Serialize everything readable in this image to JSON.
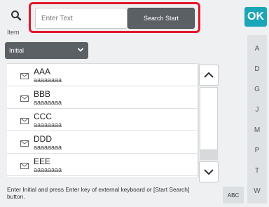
{
  "header": {
    "search_icon": "search-icon",
    "item_label": "Item",
    "text_placeholder": "Enter Text",
    "search_start_label": "Search Start",
    "ok_label": "OK",
    "highlight_color": "#e2172b",
    "ok_color": "#1aa5b8"
  },
  "filter": {
    "selected": "Initial"
  },
  "list": {
    "rows": [
      {
        "name": "AAA",
        "sub": "aaaaaaaa"
      },
      {
        "name": "BBB",
        "sub": "aaaaaaaa"
      },
      {
        "name": "CCC",
        "sub": "aaaaaaaa"
      },
      {
        "name": "DDD",
        "sub": "aaaaaaaa"
      },
      {
        "name": "EEE",
        "sub": "aaaaaaaa"
      }
    ]
  },
  "index": [
    "A",
    "D",
    "G",
    "J",
    "M",
    "P",
    "T",
    "W"
  ],
  "footer": {
    "hint": "Enter Initial and press Enter key of external keyboard or [Start Search] button.",
    "abc_label": "ABC"
  }
}
